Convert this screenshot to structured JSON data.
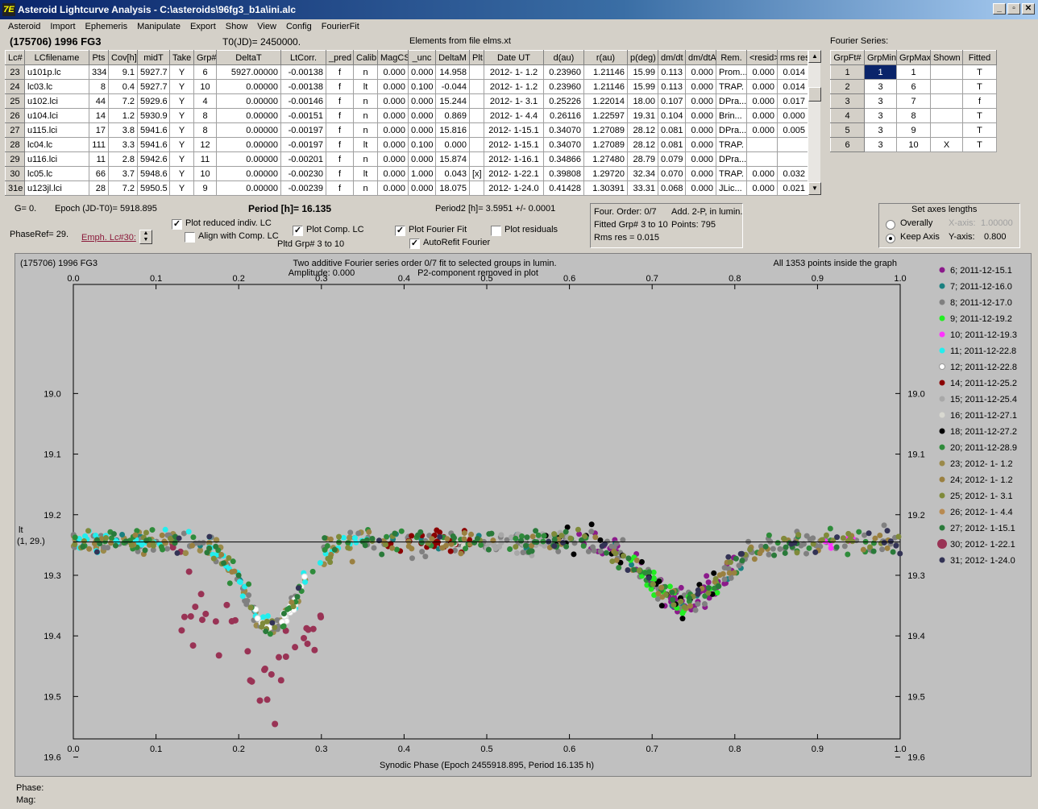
{
  "window": {
    "title": "Asteroid Lightcurve Analysis - C:\\asteroids\\96fg3_b1a\\ini.alc",
    "icon_glyph": "7E",
    "min": "_",
    "max": "▫",
    "close": "✕"
  },
  "menu": [
    "Asteroid",
    "Import",
    "Ephemeris",
    "Manipulate",
    "Export",
    "Show",
    "View",
    "Config",
    "FourierFit"
  ],
  "header": {
    "object": "(175706) 1996 FG3",
    "t0": "T0(JD)= 2450000.",
    "elements": "Elements from file elms.xt",
    "fourier_title": "Fourier Series:"
  },
  "lc_table": {
    "columns": [
      "Lc#",
      "LCfilename",
      "Pts",
      "Cov[h]",
      "midT",
      "Take",
      "Grp#",
      "DeltaT",
      "LtCorr.",
      "_pred",
      "Calib.",
      "MagCS",
      "_unc",
      "DeltaM",
      "Plt",
      "Date UT",
      "d(au)",
      "r(au)",
      "p(deg)",
      "dm/dt",
      "dm/dtA",
      "Rem.",
      "<resid>",
      "rms res"
    ],
    "rows": [
      [
        "23",
        "u101p.lc",
        "334",
        "9.1",
        "5927.7",
        "Y",
        "6",
        "5927.00000",
        "-0.00138",
        "f",
        "n",
        "0.000",
        "0.000",
        "14.958",
        "",
        "2012- 1- 1.2",
        "0.23960",
        "1.21146",
        "15.99",
        "0.113",
        "0.000",
        "Prom...",
        "0.000",
        "0.014"
      ],
      [
        "24",
        "lc03.lc",
        "8",
        "0.4",
        "5927.7",
        "Y",
        "10",
        "0.00000",
        "-0.00138",
        "f",
        "lt",
        "0.000",
        "0.100",
        "-0.044",
        "",
        "2012- 1- 1.2",
        "0.23960",
        "1.21146",
        "15.99",
        "0.113",
        "0.000",
        "TRAP.",
        "0.000",
        "0.014"
      ],
      [
        "25",
        "u102.lci",
        "44",
        "7.2",
        "5929.6",
        "Y",
        "4",
        "0.00000",
        "-0.00146",
        "f",
        "n",
        "0.000",
        "0.000",
        "15.244",
        "",
        "2012- 1- 3.1",
        "0.25226",
        "1.22014",
        "18.00",
        "0.107",
        "0.000",
        "DPra...",
        "0.000",
        "0.017"
      ],
      [
        "26",
        "u104.lci",
        "14",
        "1.2",
        "5930.9",
        "Y",
        "8",
        "0.00000",
        "-0.00151",
        "f",
        "n",
        "0.000",
        "0.000",
        "0.869",
        "",
        "2012- 1- 4.4",
        "0.26116",
        "1.22597",
        "19.31",
        "0.104",
        "0.000",
        "Brin...",
        "0.000",
        "0.000"
      ],
      [
        "27",
        "u115.lci",
        "17",
        "3.8",
        "5941.6",
        "Y",
        "8",
        "0.00000",
        "-0.00197",
        "f",
        "n",
        "0.000",
        "0.000",
        "15.816",
        "",
        "2012- 1-15.1",
        "0.34070",
        "1.27089",
        "28.12",
        "0.081",
        "0.000",
        "DPra...",
        "0.000",
        "0.005"
      ],
      [
        "28",
        "lc04.lc",
        "111",
        "3.3",
        "5941.6",
        "Y",
        "12",
        "0.00000",
        "-0.00197",
        "f",
        "lt",
        "0.000",
        "0.100",
        "0.000",
        "",
        "2012- 1-15.1",
        "0.34070",
        "1.27089",
        "28.12",
        "0.081",
        "0.000",
        "TRAP.",
        "",
        ""
      ],
      [
        "29",
        "u116.lci",
        "11",
        "2.8",
        "5942.6",
        "Y",
        "11",
        "0.00000",
        "-0.00201",
        "f",
        "n",
        "0.000",
        "0.000",
        "15.874",
        "",
        "2012- 1-16.1",
        "0.34866",
        "1.27480",
        "28.79",
        "0.079",
        "0.000",
        "DPra...",
        "",
        ""
      ],
      [
        "30",
        "lc05.lc",
        "66",
        "3.7",
        "5948.6",
        "Y",
        "10",
        "0.00000",
        "-0.00230",
        "f",
        "lt",
        "0.000",
        "1.000",
        "0.043",
        "[x]",
        "2012- 1-22.1",
        "0.39808",
        "1.29720",
        "32.34",
        "0.070",
        "0.000",
        "TRAP.",
        "0.000",
        "0.032"
      ],
      [
        "31e",
        "u123jl.lci",
        "28",
        "7.2",
        "5950.5",
        "Y",
        "9",
        "0.00000",
        "-0.00239",
        "f",
        "n",
        "0.000",
        "0.000",
        "18.075",
        "",
        "2012- 1-24.0",
        "0.41428",
        "1.30391",
        "33.31",
        "0.068",
        "0.000",
        "JLic...",
        "0.000",
        "0.021"
      ]
    ]
  },
  "fourier_table": {
    "columns": [
      "GrpFt#",
      "GrpMin",
      "GrpMax",
      "Shown",
      "Fitted"
    ],
    "rows": [
      [
        "1",
        "1",
        "1",
        "",
        "T"
      ],
      [
        "2",
        "3",
        "6",
        "",
        "T"
      ],
      [
        "3",
        "3",
        "7",
        "",
        "f"
      ],
      [
        "4",
        "3",
        "8",
        "",
        "T"
      ],
      [
        "5",
        "3",
        "9",
        "",
        "T"
      ],
      [
        "6",
        "3",
        "10",
        "X",
        "T"
      ]
    ]
  },
  "controls": {
    "g": "G= 0.",
    "epoch": "Epoch (JD-T0)= 5918.895",
    "period": "Period [h]= 16.135",
    "period2": "Period2 [h]= 3.5951 +/- 0.0001",
    "phaseref": "PhaseRef= 29.",
    "emph": "Emph. Lc#30:",
    "cb_reduced": "Plot reduced indiv. LC",
    "cb_align": "Align with Comp. LC",
    "cb_comp": "Plot Comp. LC",
    "pltd": "Pltd Grp#  3  to  10",
    "cb_fourier": "Plot Fourier Fit",
    "cb_autorefit": "AutoRefit Fourier",
    "cb_resid": "Plot residuals",
    "info1a": "Four. Order:  0/7",
    "info1b": "Add. 2-P, in lumin.",
    "info2a": "Fitted Grp# 3 to 10",
    "info2b": "Points: 795",
    "info3": "Rms res     = 0.015",
    "axes_title": "Set axes lengths",
    "r_overall": "Overally",
    "r_keep": "Keep Axis",
    "xaxis_lbl": "X-axis:",
    "xaxis_val": "1.00000",
    "yaxis_lbl": "Y-axis:",
    "yaxis_val": "0.800",
    "check": "✓"
  },
  "chart_data": {
    "type": "scatter",
    "title": "Two additive Fourier series order 0/7 fit to selected groups in lumin.",
    "subtitle": "Amplitude: 0.000",
    "note": "P2-component removed in plot",
    "object_label": "(175706) 1996 FG3",
    "points_label": "All 1353 points inside the graph",
    "xlabel": "Synodic Phase (Epoch 2455918.895, Period 16.135 h)",
    "ylabel": "lt",
    "ylabel2": "(1, 29.)",
    "xlim": [
      0,
      1
    ],
    "ylim": [
      19.57,
      18.82
    ],
    "y_reversed": true,
    "xticks": [
      "0.0",
      "0.1",
      "0.2",
      "0.3",
      "0.4",
      "0.5",
      "0.6",
      "0.7",
      "0.8",
      "0.9",
      "1.0"
    ],
    "yticks": [
      "19.0",
      "19.1",
      "19.2",
      "19.3",
      "19.4",
      "19.5",
      "19.6",
      "19.7"
    ],
    "reference_line": 19.245,
    "legend_position": "right",
    "legend": [
      {
        "name": "6; 2011-12-15.1",
        "color": "#8b1a8b"
      },
      {
        "name": "7; 2011-12-16.0",
        "color": "#1a8080"
      },
      {
        "name": "8; 2011-12-17.0",
        "color": "#808080"
      },
      {
        "name": "9; 2011-12-19.2",
        "color": "#22ee22"
      },
      {
        "name": "10; 2011-12-19.3",
        "color": "#ff33ff"
      },
      {
        "name": "11; 2011-12-22.8",
        "color": "#22eeee"
      },
      {
        "name": "12; 2011-12-22.8",
        "color": "#ffffff"
      },
      {
        "name": "14; 2011-12-25.2",
        "color": "#8b0000"
      },
      {
        "name": "15; 2011-12-25.4",
        "color": "#a8a8a8"
      },
      {
        "name": "16; 2011-12-27.1",
        "color": "#d8d8d0"
      },
      {
        "name": "18; 2011-12-27.2",
        "color": "#000000"
      },
      {
        "name": "20; 2011-12-28.9",
        "color": "#2e8b3a"
      },
      {
        "name": "23; 2012- 1- 1.2",
        "color": "#9b8a4a"
      },
      {
        "name": "24; 2012- 1- 1.2",
        "color": "#9a8040"
      },
      {
        "name": "25; 2012- 1- 3.1",
        "color": "#7f8a3a"
      },
      {
        "name": "26; 2012- 1- 4.4",
        "color": "#b88a50"
      },
      {
        "name": "27; 2012- 1-15.1",
        "color": "#2a7a3a"
      },
      {
        "name": "30; 2012- 1-22.1",
        "color": "#993355"
      },
      {
        "name": "31; 2012- 1-24.0",
        "color": "#333355"
      }
    ]
  },
  "status": {
    "phase": "Phase:",
    "mag": "Mag:"
  }
}
